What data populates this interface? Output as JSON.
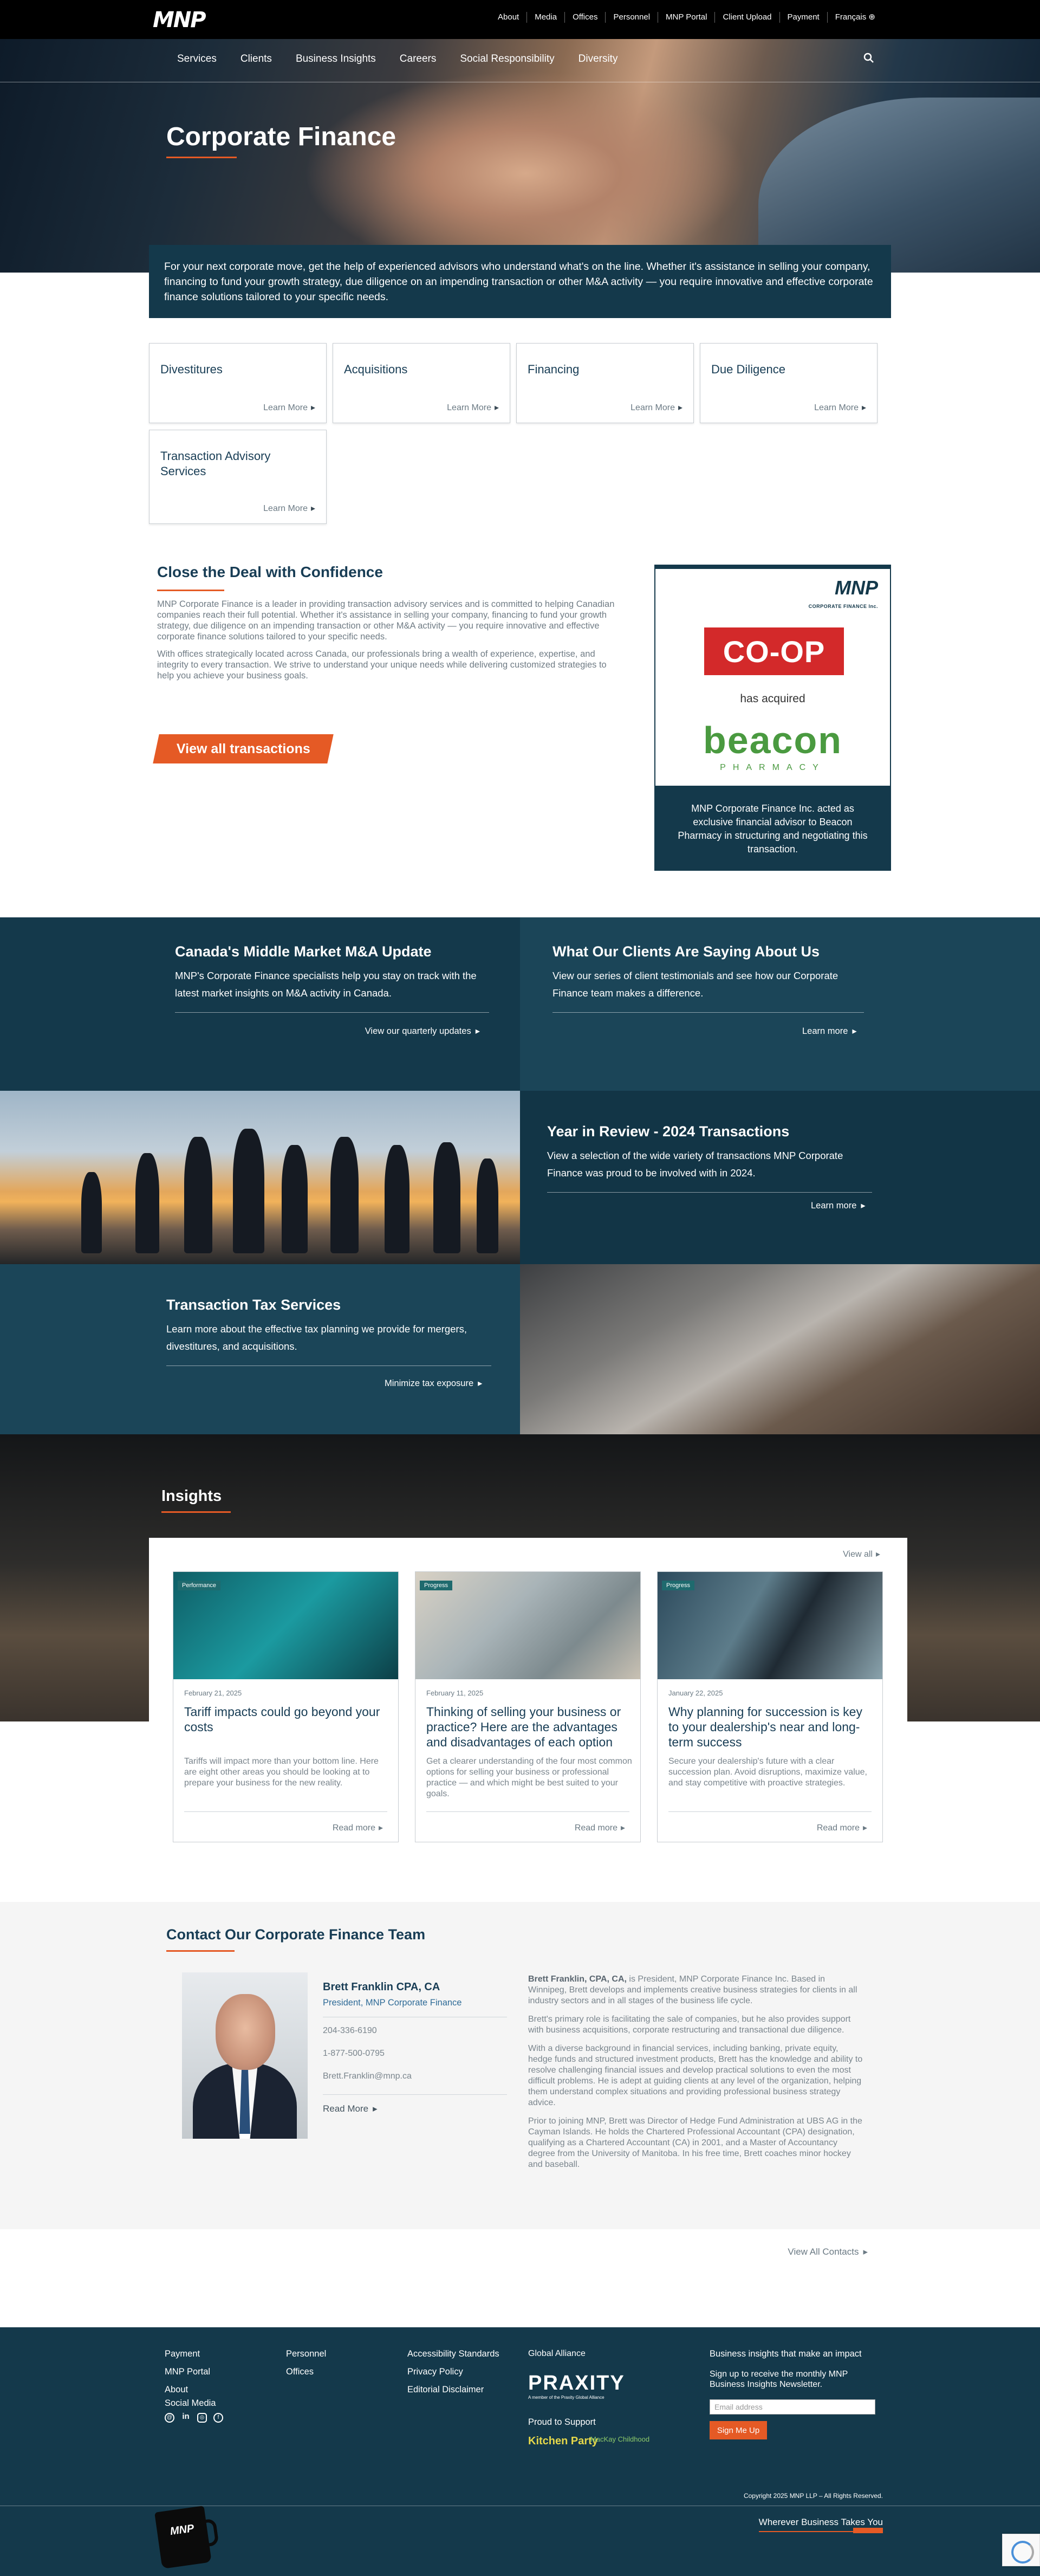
{
  "site": {
    "logo": "MNP"
  },
  "utility_nav": [
    "About",
    "Media",
    "Offices",
    "Personnel",
    "MNP Portal",
    "Client Upload",
    "Payment",
    "Français"
  ],
  "main_nav": [
    "Services",
    "Clients",
    "Business Insights",
    "Careers",
    "Social Responsibility",
    "Diversity"
  ],
  "hero": {
    "title": "Corporate Finance",
    "intro": "For your next corporate move, get the help of experienced advisors who understand what's on the line. Whether it's assistance in selling your company, financing to fund your growth strategy, due diligence on an impending transaction or other M&A activity — you require innovative and effective corporate finance solutions tailored to your specific needs."
  },
  "services": {
    "learn_more": "Learn More",
    "items": [
      "Divestitures",
      "Acquisitions",
      "Financing",
      "Due Diligence",
      "Transaction Advisory Services"
    ]
  },
  "close_deal": {
    "title": "Close the Deal with Confidence",
    "p1": "MNP Corporate Finance is a leader in providing transaction advisory services and is committed to helping Canadian companies reach their full potential. Whether it's assistance in selling your company, financing to fund your growth strategy, due diligence on an impending transaction or other M&A activity — you require innovative and effective corporate finance solutions tailored to your specific needs.",
    "p2": "With offices strategically located across Canada, our professionals bring a wealth of experience, expertise, and integrity to every transaction. We strive to understand your unique needs while delivering customized strategies to help you achieve your business goals.",
    "button": "View all transactions"
  },
  "deal_card": {
    "brand": "MNP",
    "brand_sub": "CORPORATE FINANCE Inc.",
    "buyer": "CO-OP",
    "has_acquired": "has acquired",
    "target": "beacon",
    "target_sub": "PHARMACY",
    "caption": "MNP Corporate Finance Inc. acted as exclusive financial advisor to Beacon Pharmacy in structuring and negotiating this transaction."
  },
  "tiles": [
    {
      "title": "Canada's Middle Market M&A Update",
      "text": "MNP's Corporate Finance specialists help you stay on track with the latest market insights on M&A activity in Canada.",
      "link": "View our quarterly updates"
    },
    {
      "title": "What Our Clients Are Saying About Us",
      "text": "View our series of client testimonials and see how our Corporate Finance team makes a difference.",
      "link": "Learn more"
    },
    {
      "title": "Year in Review - 2024 Transactions",
      "text": "View a selection of the wide variety of transactions MNP Corporate Finance was proud to be involved with in 2024.",
      "link": "Learn more"
    },
    {
      "title": "Transaction Tax Services",
      "text": "Learn more about the effective tax planning we provide for mergers, divestitures, and acquisitions.",
      "link": "Minimize tax exposure"
    }
  ],
  "insights": {
    "title": "Insights",
    "view_all": "View all",
    "read_more": "Read more",
    "cards": [
      {
        "tag": "Performance",
        "date": "February 21, 2025",
        "title": "Tariff impacts could go beyond your costs",
        "desc": "Tariffs will impact more than your bottom line. Here are eight other areas you should be looking at to prepare your business for the new reality."
      },
      {
        "tag": "Progress",
        "date": "February 11, 2025",
        "title": "Thinking of selling your business or practice? Here are the advantages and disadvantages of each option",
        "desc": "Get a clearer understanding of the four most common options for selling your business or professional practice — and which might be best suited to your goals."
      },
      {
        "tag": "Progress",
        "date": "January 22, 2025",
        "title": "Why planning for succession is key to your dealership's near and long-term success",
        "desc": "Secure your dealership's future with a clear succession plan. Avoid disruptions, maximize value, and stay competitive with proactive strategies."
      }
    ]
  },
  "contact": {
    "title": "Contact Our Corporate Finance Team",
    "name": "Brett Franklin CPA, CA",
    "role": "President, MNP Corporate Finance",
    "phone1": "204-336-6190",
    "phone2": "1-877-500-0795",
    "email": "Brett.Franklin@mnp.ca",
    "read_more": "Read More",
    "bio_name": "Brett Franklin, CPA, CA,",
    "bio": [
      "is President, MNP Corporate Finance Inc. Based in Winnipeg, Brett develops and implements creative business strategies for clients in all industry sectors and in all stages of the business life cycle.",
      "Brett's primary role is facilitating the sale of companies, but he also provides support with business acquisitions, corporate restructuring and transactional due diligence.",
      "With a diverse background in financial services, including banking, private equity, hedge funds and structured investment products, Brett has the knowledge and ability to resolve challenging financial issues and develop practical solutions to even the most difficult problems. He is adept at guiding clients at any level of the organization, helping them understand complex situations and providing professional business strategy advice.",
      "Prior to joining MNP, Brett was Director of Hedge Fund Administration at UBS AG in the Cayman Islands. He holds the Chartered Professional Accountant (CPA) designation, qualifying as a Chartered Accountant (CA) in 2001, and a Master of Accountancy degree from the University of Manitoba. In his free time, Brett coaches minor hockey and baseball."
    ],
    "view_all": "View All Contacts"
  },
  "footer": {
    "col1": [
      "Payment",
      "MNP Portal",
      "About",
      "Social Media"
    ],
    "col2": [
      "Personnel",
      "Offices"
    ],
    "col3": [
      "Accessibility Standards",
      "Privacy Policy",
      "Editorial Disclaimer"
    ],
    "global": "Global Alliance",
    "praxity": "PRAXITY",
    "praxity_sub": "A member of the Praxity Global Alliance",
    "support": "Proud to Support",
    "kp": "Kitchen Party",
    "mk": "MacKay Childhood",
    "news_head": "Business insights that make an impact",
    "news_sub": "Sign up to receive the monthly MNP Business Insights Newsletter.",
    "email_ph": "Email address",
    "signup": "Sign Me Up",
    "copyright": "Copyright 2025 MNP LLP – All Rights Reserved.",
    "tagline": "Wherever Business Takes You",
    "mug": "MNP"
  }
}
